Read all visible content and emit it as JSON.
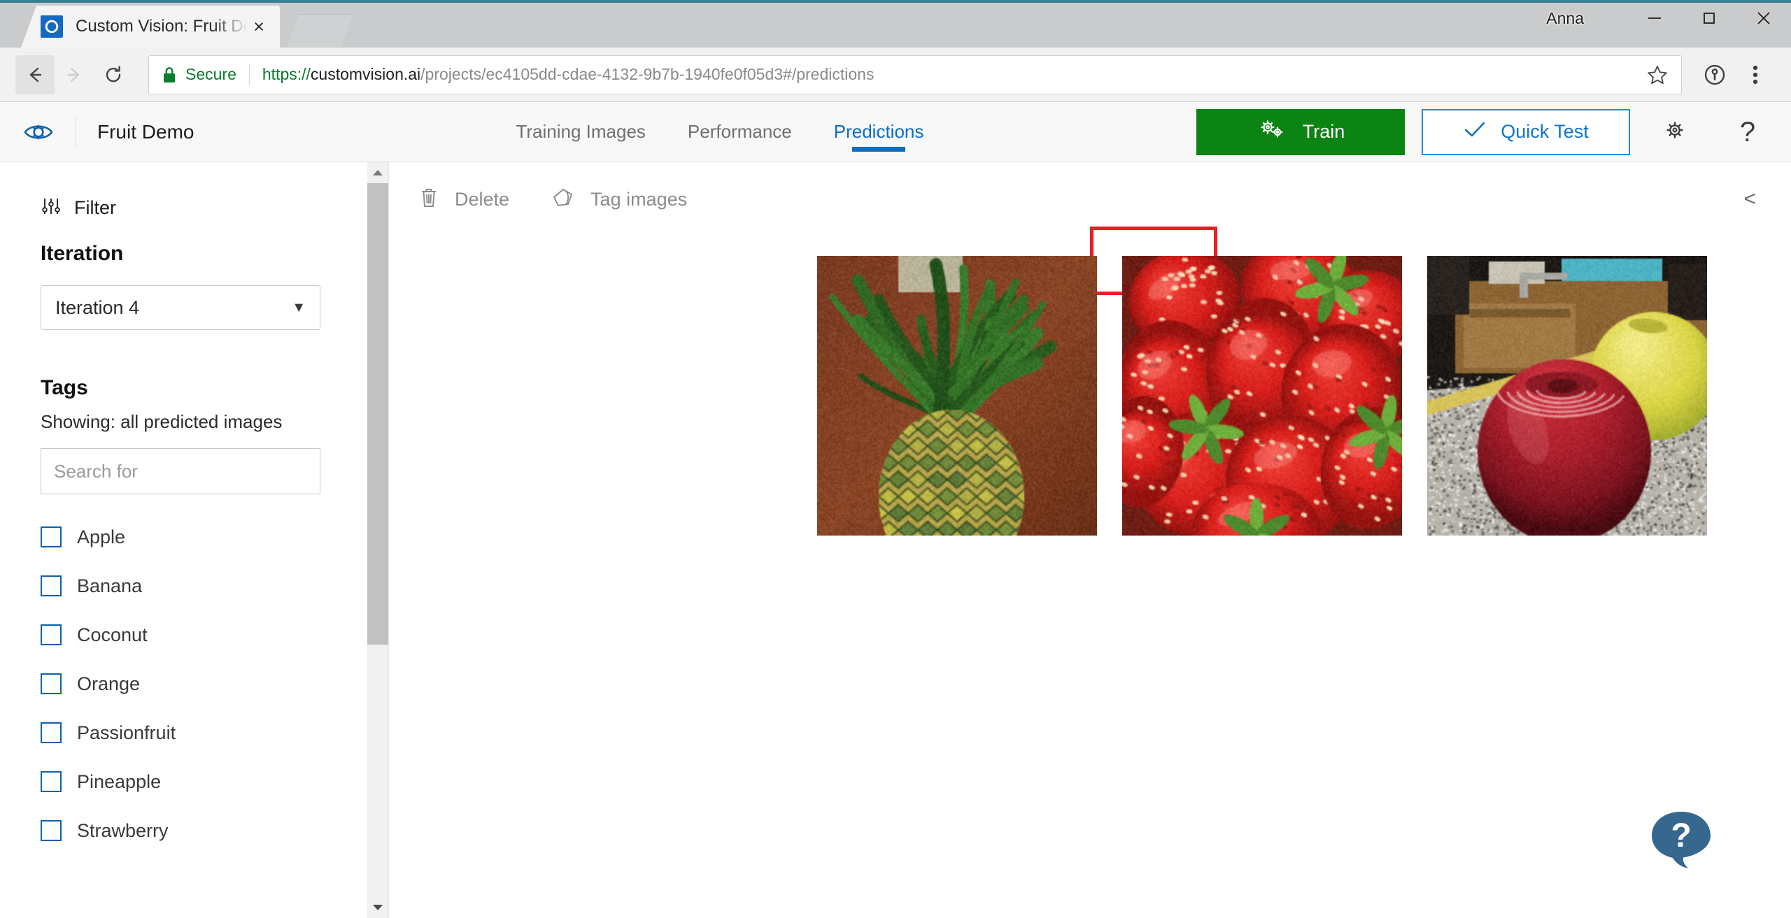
{
  "window": {
    "user_label": "Anna",
    "minimize_label": "Minimize",
    "maximize_label": "Maximize",
    "close_label": "Close"
  },
  "browser": {
    "tab": {
      "title": "Custom Vision: Fruit Dem",
      "favicon": "custom-vision-icon",
      "close_label": "×"
    },
    "new_tab_label": "",
    "back_icon": "arrow-left-icon",
    "forward_icon": "arrow-right-icon",
    "reload_icon": "reload-icon",
    "security": {
      "lock_icon": "lock-icon",
      "label": "Secure"
    },
    "url": {
      "scheme": "https://",
      "host": "customvision.ai",
      "path": "/projects/ec4105dd-cdae-4132-9b7b-1940fe0f05d3#/predictions",
      "full": "https://customvision.ai/projects/ec4105dd-cdae-4132-9b7b-1940fe0f05d3#/predictions"
    },
    "bookmark_icon": "star-icon",
    "password_icon": "key-circle-icon",
    "menu_icon": "three-dots-icon"
  },
  "app_header": {
    "logo_icon": "custom-vision-eye-gear-icon",
    "project_name": "Fruit Demo",
    "tabs": [
      {
        "label": "Training Images",
        "active": false
      },
      {
        "label": "Performance",
        "active": false
      },
      {
        "label": "Predictions",
        "active": true
      }
    ],
    "train_button": {
      "label": "Train",
      "icon": "gears-icon",
      "color": "#0b8413"
    },
    "quick_test_button": {
      "label": "Quick Test",
      "icon": "check-icon",
      "color": "#2b88d8"
    },
    "settings_icon": "gear-icon",
    "help_icon": "question-mark-icon",
    "annotation": {
      "color": "#ee1c25",
      "target": "Predictions"
    }
  },
  "sidebar": {
    "filter": {
      "label": "Filter",
      "icon": "sliders-icon"
    },
    "iteration": {
      "heading": "Iteration",
      "selected": "Iteration 4",
      "caret": "▼"
    },
    "tags": {
      "heading": "Tags",
      "showing": "Showing: all predicted images",
      "search_placeholder": "Search for",
      "search_value": "",
      "items": [
        {
          "label": "Apple",
          "checked": false
        },
        {
          "label": "Banana",
          "checked": false
        },
        {
          "label": "Coconut",
          "checked": false
        },
        {
          "label": "Orange",
          "checked": false
        },
        {
          "label": "Passionfruit",
          "checked": false
        },
        {
          "label": "Pineapple",
          "checked": false
        },
        {
          "label": "Strawberry",
          "checked": false
        }
      ]
    },
    "scrollbar": {
      "up_arrow": "▲",
      "down_arrow": "▼"
    }
  },
  "content": {
    "toolbar": {
      "delete": {
        "label": "Delete",
        "icon": "trash-icon",
        "enabled": false
      },
      "tag_images": {
        "label": "Tag images",
        "icon": "tag-icon",
        "enabled": false
      },
      "collapse": {
        "label": "<",
        "icon": "chevron-left-icon"
      }
    },
    "images": [
      {
        "alt": "pineapple",
        "kind": "pineapple"
      },
      {
        "alt": "strawberries",
        "kind": "strawberries"
      },
      {
        "alt": "apple",
        "kind": "apple"
      }
    ],
    "help_fab": {
      "icon": "help-bubble-icon",
      "glyph": "?",
      "color": "#36688f"
    }
  }
}
